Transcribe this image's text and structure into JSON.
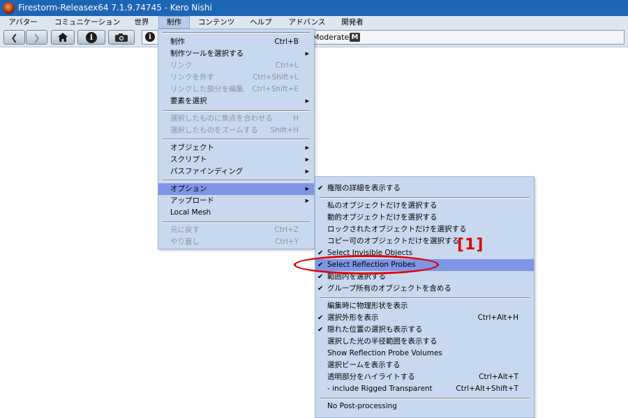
{
  "window": {
    "title": "Firestorm-Releasex64 7.1.9.74745 - Kero Nishi"
  },
  "menubar": {
    "items": [
      {
        "label": "アバター"
      },
      {
        "label": "コミュニケーション"
      },
      {
        "label": "世界"
      },
      {
        "label": "制作",
        "active": true
      },
      {
        "label": "コンテンツ"
      },
      {
        "label": "ヘルプ"
      },
      {
        "label": "アドバンス"
      },
      {
        "label": "開発者"
      }
    ]
  },
  "toolbar": {
    "back_icon": "back-arrow-icon",
    "forward_icon": "forward-arrow-icon",
    "home_icon": "home-icon",
    "info_icon": "info-icon",
    "snapshot_icon": "camera-icon",
    "location_info_glyph": "i",
    "maturity": "Moderate",
    "maturity_badge": "M"
  },
  "build_menu": {
    "items": [
      {
        "label": "制作",
        "shortcut": "Ctrl+B"
      },
      {
        "label": "制作ツールを選択する",
        "submenu": true
      },
      {
        "label": "リンク",
        "shortcut": "Ctrl+L",
        "disabled": true
      },
      {
        "label": "リンクを外す",
        "shortcut": "Ctrl+Shift+L",
        "disabled": true
      },
      {
        "label": "リンクした部分を編集",
        "shortcut": "Ctrl+Shift+E",
        "disabled": true
      },
      {
        "label": "要素を選択",
        "submenu": true
      },
      {
        "label": "選択したものに焦点を合わせる",
        "shortcut": "H",
        "disabled": true
      },
      {
        "label": "選択したものをズームする",
        "shortcut": "Shift+H",
        "disabled": true
      },
      {
        "label": "オブジェクト",
        "submenu": true
      },
      {
        "label": "スクリプト",
        "submenu": true
      },
      {
        "label": "パスファインディング",
        "submenu": true
      },
      {
        "label": "オプション",
        "submenu": true,
        "highlighted": true
      },
      {
        "label": "アップロード",
        "submenu": true
      },
      {
        "label": "Local Mesh"
      },
      {
        "label": "元に戻す",
        "shortcut": "Ctrl+Z",
        "disabled": true
      },
      {
        "label": "やり直し",
        "shortcut": "Ctrl+Y",
        "disabled": true
      }
    ]
  },
  "options_submenu": {
    "items": [
      {
        "label": "権限の詳細を表示する",
        "checked": true
      },
      {
        "label": "私のオブジェクトだけを選択する"
      },
      {
        "label": "動的オブジェクトだけを選択する"
      },
      {
        "label": "ロックされたオブジェクトだけを選択する"
      },
      {
        "label": "コピー可のオブジェクトだけを選択する"
      },
      {
        "label": "Select Invisible Objects",
        "checked": true
      },
      {
        "label": "Select Reflection Probes",
        "checked": true,
        "highlighted": true
      },
      {
        "label": "範囲内を選択する",
        "checked": true
      },
      {
        "label": "グループ所有のオブジェクトを含める",
        "checked": true
      },
      {
        "label": "編集時に物理形状を表示"
      },
      {
        "label": "選択外形を表示",
        "checked": true,
        "shortcut": "Ctrl+Alt+H"
      },
      {
        "label": "隠れた位置の選択も表示する",
        "checked": true
      },
      {
        "label": "選択した光の半径範囲を表示する"
      },
      {
        "label": "Show Reflection Probe Volumes"
      },
      {
        "label": "選択ビームを表示する"
      },
      {
        "label": "透明部分をハイライトする",
        "shortcut": "Ctrl+Alt+T"
      },
      {
        "label": "- include Rigged Transparent",
        "shortcut": "Ctrl+Alt+Shift+T"
      },
      {
        "label": "No Post-processing"
      }
    ]
  },
  "annotation": {
    "label": "[1]",
    "color": "#e00000"
  },
  "colors": {
    "titlebar": "#1c66b5",
    "menu_bg": "#c8d9ef",
    "highlight": "#7f95e6"
  }
}
